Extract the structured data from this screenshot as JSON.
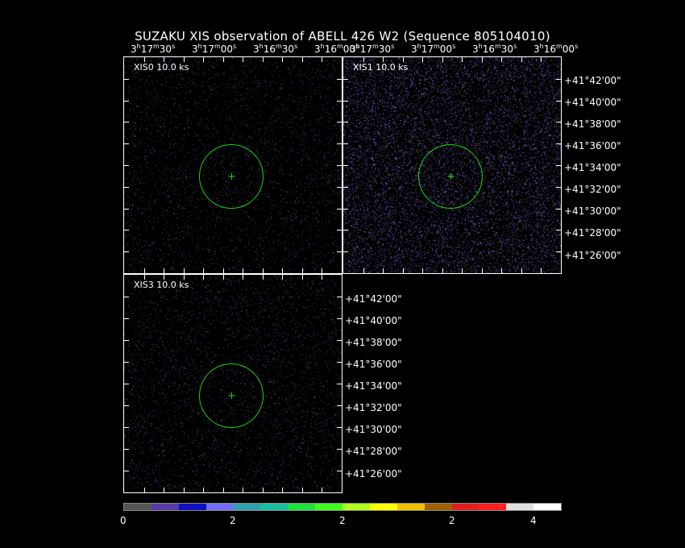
{
  "title": "SUZAKU XIS observation of ABELL 426 W2  (Sequence 805104010)",
  "panels": [
    {
      "label": "XIS0 10.0 ks",
      "name": "panel-xis0"
    },
    {
      "label": "XIS1 10.0 ks",
      "name": "panel-xis1"
    },
    {
      "label": "XIS3 10.0 ks",
      "name": "panel-xis3"
    }
  ],
  "ra_ticks": {
    "h": "3",
    "m1": "17",
    "s1": "30",
    "m2": "17",
    "s2": "00",
    "m3": "16",
    "s3": "30",
    "m4": "16",
    "s4": "00"
  },
  "dec_labels": [
    "+41°42'00\"",
    "+41°40'00\"",
    "+41°38'00\"",
    "+41°36'00\"",
    "+41°34'00\"",
    "+41°32'00\"",
    "+41°30'00\"",
    "+41°28'00\"",
    "+41°26'00\""
  ],
  "colorbar": {
    "colors": [
      "#555555",
      "#5a3aa8",
      "#1010c0",
      "#7070ff",
      "#30a0b0",
      "#18c0a0",
      "#20e040",
      "#40ff20",
      "#b0ff20",
      "#ffff00",
      "#f0c000",
      "#a06000",
      "#e02020",
      "#ff2020",
      "#e0e0e0",
      "#ffffff"
    ],
    "labels": [
      "0",
      "2",
      "2",
      "2",
      "4"
    ]
  },
  "overlay_color": "#18d018"
}
